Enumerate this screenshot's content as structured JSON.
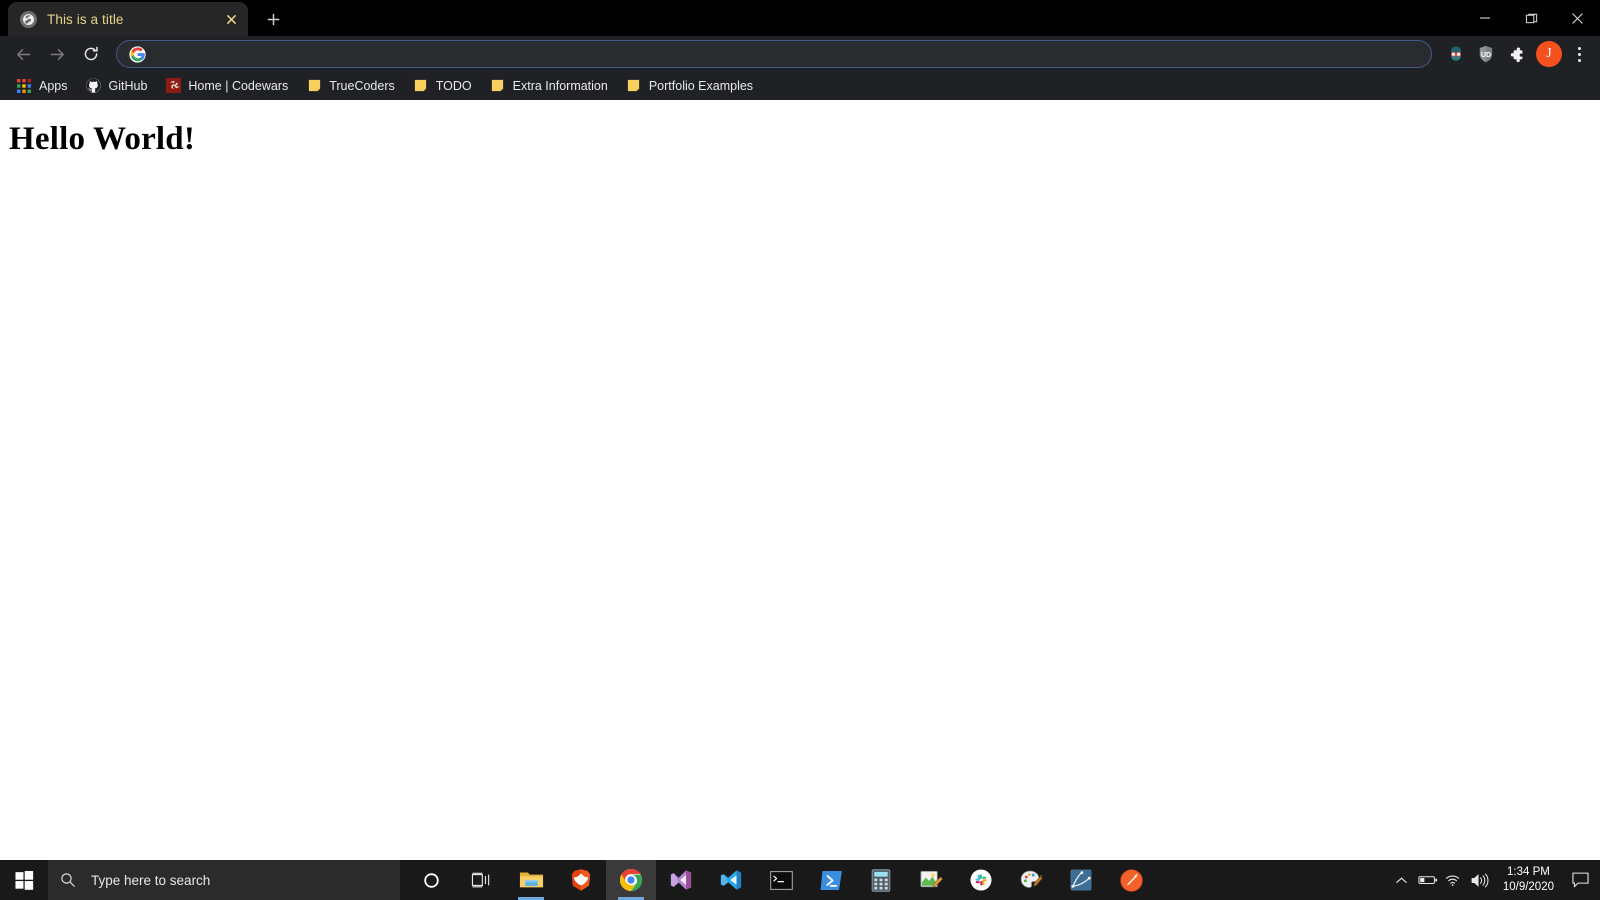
{
  "window": {
    "controls": {
      "minimize_label": "Minimize",
      "maximize_label": "Restore",
      "close_label": "Close"
    }
  },
  "tabstrip": {
    "tabs": [
      {
        "title": "This is a title",
        "favicon": "globe-page-icon",
        "close_label": "×",
        "title_color": "#e8d48a",
        "active": true
      }
    ],
    "new_tab_label": "+"
  },
  "toolbar": {
    "back_label": "Back",
    "forward_label": "Forward",
    "reload_label": "Reload",
    "omnibox": {
      "value": "",
      "placeholder": "",
      "leading_icon": "google-g-icon",
      "focus_ring_color": "#3f5a86"
    },
    "extensions": [
      {
        "name": "grammar-assistant-extension-icon",
        "label": ""
      },
      {
        "name": "urban-dictionary-shield-extension-icon",
        "label": "UD"
      },
      {
        "name": "extensions-puzzle-icon",
        "label": ""
      }
    ],
    "profile": {
      "initial": "J",
      "color": "#f4511e"
    },
    "menu_label": "Customize and control Google Chrome"
  },
  "bookmarks": [
    {
      "label": "Apps",
      "icon": "apps-grid-icon"
    },
    {
      "label": "GitHub",
      "icon": "github-octocat-icon"
    },
    {
      "label": "Home | Codewars",
      "icon": "codewars-icon"
    },
    {
      "label": "TrueCoders",
      "icon": "bookmark-folder-icon"
    },
    {
      "label": "TODO",
      "icon": "bookmark-folder-icon"
    },
    {
      "label": "Extra Information",
      "icon": "bookmark-folder-icon"
    },
    {
      "label": "Portfolio Examples",
      "icon": "bookmark-folder-icon"
    }
  ],
  "page": {
    "heading": "Hello World!",
    "background": "#ffffff"
  },
  "taskbar": {
    "start_label": "Start",
    "search": {
      "placeholder": "Type here to search",
      "value": ""
    },
    "items": [
      {
        "name": "cortana-icon",
        "label": "Cortana",
        "state": "idle"
      },
      {
        "name": "task-view-icon",
        "label": "Task View",
        "state": "idle"
      },
      {
        "name": "file-explorer-icon",
        "label": "File Explorer",
        "state": "running"
      },
      {
        "name": "brave-browser-icon",
        "label": "Brave",
        "state": "idle"
      },
      {
        "name": "google-chrome-icon",
        "label": "Google Chrome",
        "state": "active"
      },
      {
        "name": "visual-studio-icon",
        "label": "Visual Studio",
        "state": "idle"
      },
      {
        "name": "vs-code-icon",
        "label": "Visual Studio Code",
        "state": "idle"
      },
      {
        "name": "command-prompt-icon",
        "label": "Command Prompt",
        "state": "idle"
      },
      {
        "name": "powershell-icon",
        "label": "Windows PowerShell",
        "state": "idle"
      },
      {
        "name": "calculator-icon",
        "label": "Calculator",
        "state": "idle"
      },
      {
        "name": "paint-icon",
        "label": "Paint",
        "state": "idle"
      },
      {
        "name": "slack-icon",
        "label": "Slack",
        "state": "idle"
      },
      {
        "name": "paint-3d-icon",
        "label": "Paint 3D",
        "state": "idle"
      },
      {
        "name": "inkscape-icon",
        "label": "Inkscape",
        "state": "idle"
      },
      {
        "name": "thermometer-app-icon",
        "label": "App",
        "state": "idle"
      }
    ],
    "tray": [
      {
        "name": "show-hidden-icons-chevron-icon",
        "label": "Show hidden icons"
      },
      {
        "name": "battery-icon",
        "label": "Battery"
      },
      {
        "name": "wifi-icon",
        "label": "Network"
      },
      {
        "name": "volume-icon",
        "label": "Volume"
      }
    ],
    "clock": {
      "time": "1:34 PM",
      "date": "10/9/2020"
    },
    "action_center_label": "Notifications"
  }
}
